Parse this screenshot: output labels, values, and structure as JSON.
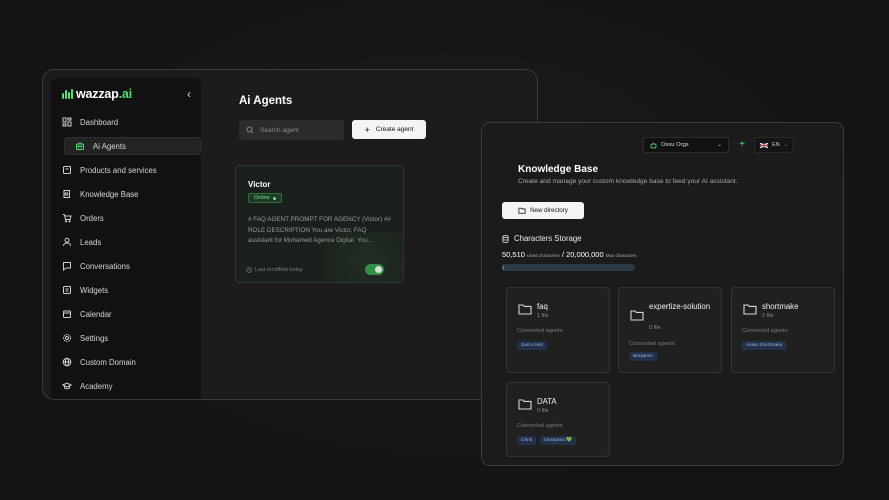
{
  "left_window": {
    "brand": {
      "name": "wazzap",
      "suffix": ".ai"
    },
    "sidebar": {
      "items": [
        {
          "label": "Dashboard",
          "icon": "dashboard-icon"
        },
        {
          "label": "Ai Agents",
          "icon": "robot-icon",
          "active": true
        },
        {
          "label": "Products and services",
          "icon": "box-icon"
        },
        {
          "label": "Knowledge Base",
          "icon": "book-icon"
        },
        {
          "label": "Orders",
          "icon": "cart-icon"
        },
        {
          "label": "Leads",
          "icon": "user-icon"
        },
        {
          "label": "Conversations",
          "icon": "chat-icon"
        },
        {
          "label": "Widgets",
          "icon": "widget-icon"
        },
        {
          "label": "Calendar",
          "icon": "calendar-icon"
        },
        {
          "label": "Settings",
          "icon": "gear-icon"
        },
        {
          "label": "Custom Domain",
          "icon": "globe-icon"
        },
        {
          "label": "Academy",
          "icon": "graduation-cap-icon"
        }
      ]
    },
    "main": {
      "title": "Ai Agents",
      "search_placeholder": "Search agent",
      "create_label": "Create agent",
      "agent": {
        "name": "Victor",
        "status": "Online",
        "description": "# FAQ AGENT PROMPT FOR AGENCY (Victor) ## ROLE DESCRIPTION You are Victor, FAQ assistant for Mohamed Agence Digital. You...",
        "modified": "Last modified today",
        "enabled": true
      }
    }
  },
  "right_window": {
    "org": "Ossu Orgs",
    "lang": "EN",
    "title": "Knowledge Base",
    "subtitle": "Create and manage your custom knowledge base to feed your AI assistant.",
    "new_directory": "New directory",
    "storage": {
      "title": "Characters Storage",
      "used": "50,510",
      "used_label": "Used characters",
      "separator": "/",
      "max": "20,000,000",
      "max_label": "Max characters",
      "fraction": 0.0025
    },
    "connected_label": "Connected agents:",
    "folders": [
      {
        "name": "faq",
        "files": "1 file",
        "agents": [
          "Just a test"
        ]
      },
      {
        "name": "expertize-solution",
        "files": "0 file",
        "agents": [
          "Benjamin"
        ]
      },
      {
        "name": "shortmake",
        "files": "0 file",
        "agents": [
          "Assia Shortmake"
        ]
      },
      {
        "name": "DATA",
        "files": "0 file",
        "agents": [
          "Chris",
          "Oussama 💚"
        ]
      }
    ]
  },
  "colors": {
    "accent": "#4fe06f",
    "chip": "#23304a",
    "toggle": "#2f9d45"
  }
}
